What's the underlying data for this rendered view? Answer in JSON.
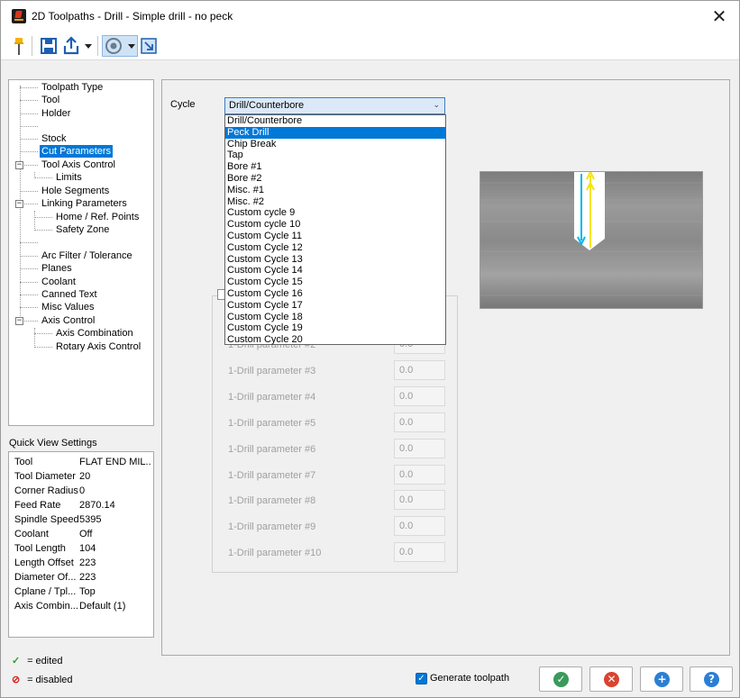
{
  "window": {
    "title": "2D Toolpaths - Drill - Simple drill - no peck",
    "close_glyph": "✕"
  },
  "toolbar": {
    "icons": [
      "pin-icon",
      "save-icon",
      "export-icon",
      "dropdown-arrow-icon",
      "settings-dial-icon",
      "dropdown-arrow-icon",
      "resize-icon"
    ]
  },
  "tree": {
    "items": [
      {
        "label": "Toolpath Type"
      },
      {
        "label": "Tool"
      },
      {
        "label": "Holder"
      },
      {
        "label": ""
      },
      {
        "label": "Stock"
      },
      {
        "label": "Cut Parameters",
        "selected": true
      },
      {
        "label": "Tool Axis Control"
      },
      {
        "label": "Limits"
      },
      {
        "label": "Hole Segments"
      },
      {
        "label": "Linking Parameters"
      },
      {
        "label": "Home / Ref. Points"
      },
      {
        "label": "Safety Zone"
      },
      {
        "label": ""
      },
      {
        "label": "Arc Filter / Tolerance"
      },
      {
        "label": "Planes"
      },
      {
        "label": "Coolant"
      },
      {
        "label": "Canned Text"
      },
      {
        "label": "Misc Values"
      },
      {
        "label": "Axis Control"
      },
      {
        "label": "Axis Combination"
      },
      {
        "label": "Rotary Axis Control"
      }
    ]
  },
  "quick_view": {
    "title": "Quick View Settings",
    "rows": [
      {
        "key": "Tool",
        "value": "FLAT END MIL..."
      },
      {
        "key": "Tool Diameter",
        "value": "20"
      },
      {
        "key": "Corner Radius",
        "value": "0"
      },
      {
        "key": "Feed Rate",
        "value": "2870.14"
      },
      {
        "key": "Spindle Speed",
        "value": "5395"
      },
      {
        "key": "Coolant",
        "value": "Off"
      },
      {
        "key": "Tool Length",
        "value": "104"
      },
      {
        "key": "Length Offset",
        "value": "223"
      },
      {
        "key": "Diameter Of...",
        "value": "223"
      },
      {
        "key": "Cplane / Tpl...",
        "value": "Top"
      },
      {
        "key": "Axis Combin...",
        "value": "Default (1)"
      }
    ]
  },
  "legend": {
    "edited_icon": "✓",
    "edited_label": "= edited",
    "disabled_icon": "⊘",
    "disabled_label": "= disabled",
    "edited_color": "#2ca02c",
    "disabled_color": "#d62020"
  },
  "cycle": {
    "label": "Cycle",
    "selected": "Drill/Counterbore",
    "options": [
      "Drill/Counterbore",
      "Peck Drill",
      "Chip Break",
      "Tap",
      "Bore #1",
      "Bore #2",
      "Misc. #1",
      "Misc. #2",
      "Custom cycle 9",
      "Custom cycle 10",
      "Custom Cycle 11",
      "Custom Cycle 12",
      "Custom Cycle 13",
      "Custom Cycle 14",
      "Custom Cycle 15",
      "Custom Cycle 16",
      "Custom Cycle 17",
      "Custom Cycle 18",
      "Custom Cycle 19",
      "Custom Cycle 20"
    ],
    "highlighted_index": 1
  },
  "params": [
    {
      "label": "1-Drill parameter #2",
      "value": "0.0"
    },
    {
      "label": "1-Drill parameter #3",
      "value": "0.0"
    },
    {
      "label": "1-Drill parameter #4",
      "value": "0.0"
    },
    {
      "label": "1-Drill parameter #5",
      "value": "0.0"
    },
    {
      "label": "1-Drill parameter #6",
      "value": "0.0"
    },
    {
      "label": "1-Drill parameter #7",
      "value": "0.0"
    },
    {
      "label": "1-Drill parameter #8",
      "value": "0.0"
    },
    {
      "label": "1-Drill parameter #9",
      "value": "0.0"
    },
    {
      "label": "1-Drill parameter #10",
      "value": "0.0"
    }
  ],
  "footer": {
    "generate_label": "Generate toolpath",
    "generate_checked": true,
    "buttons": [
      {
        "name": "ok-button",
        "glyph": "✓",
        "color": "#3a9a5b"
      },
      {
        "name": "cancel-button",
        "glyph": "✕",
        "color": "#d9432f"
      },
      {
        "name": "apply-button",
        "glyph": "+",
        "color": "#2a7fd4"
      },
      {
        "name": "help-button",
        "glyph": "?",
        "color": "#2a7fd4"
      }
    ]
  }
}
